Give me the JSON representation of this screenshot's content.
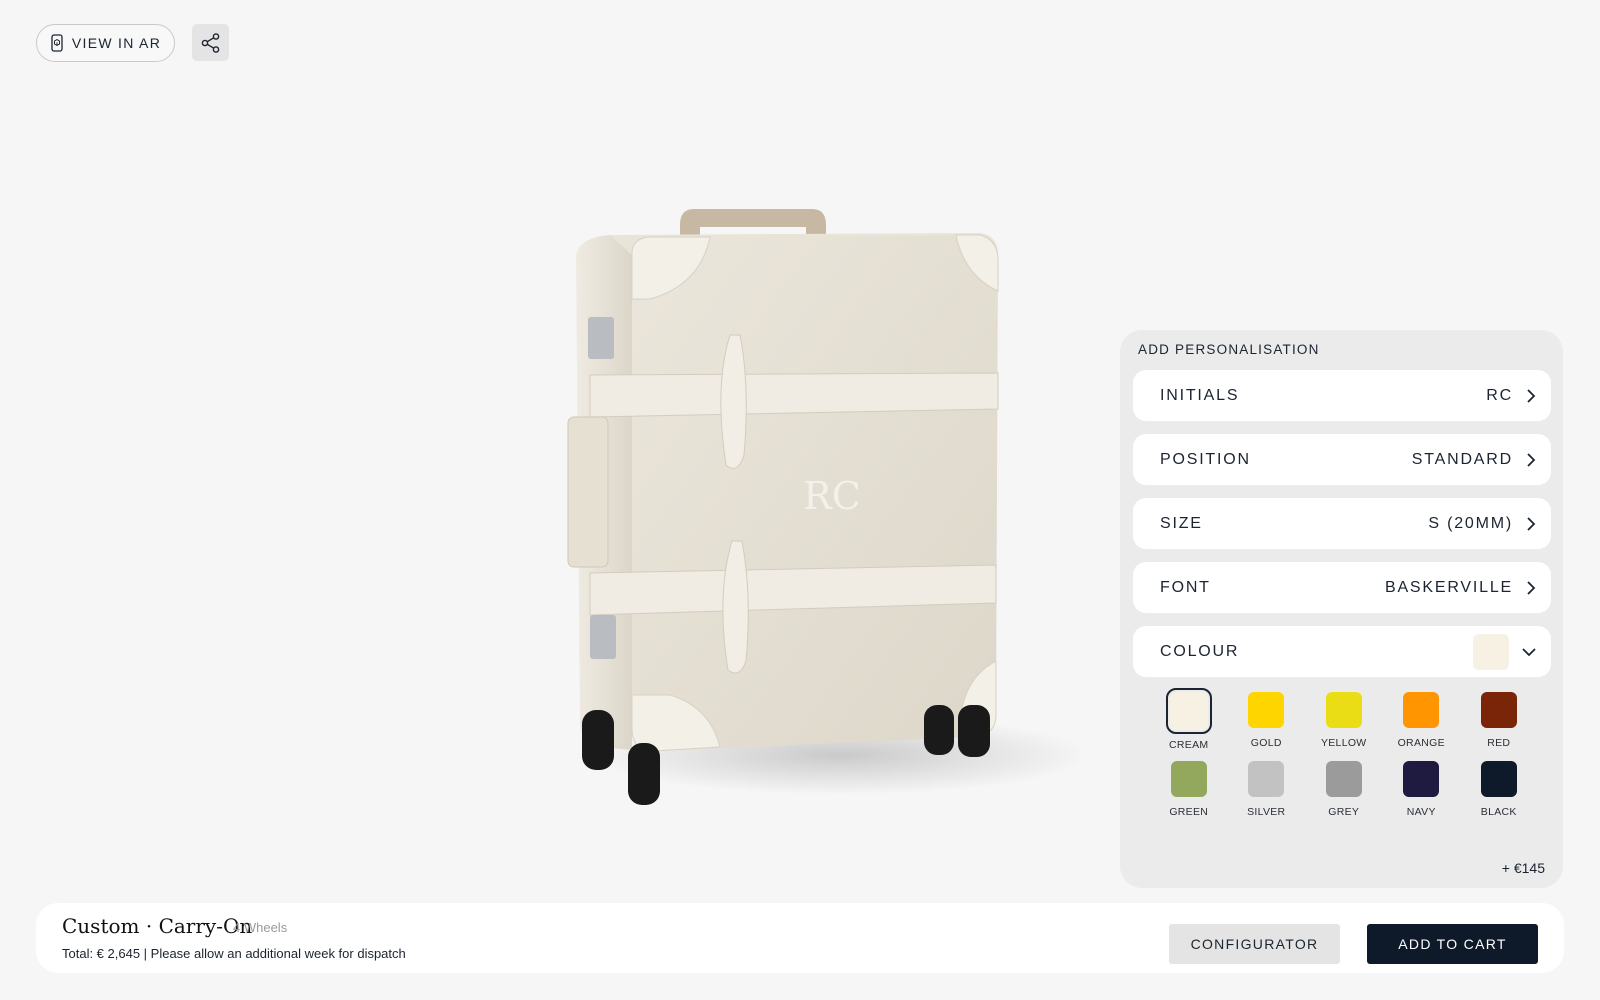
{
  "toolbar": {
    "ar_label": "VIEW IN AR",
    "ar_icon": "ar-phone-icon",
    "share_icon": "share-icon"
  },
  "product_view": {
    "monogram": "RC",
    "case_color": "#e6e0d4"
  },
  "personalisation": {
    "title": "ADD PERSONALISATION",
    "rows": [
      {
        "label": "INITIALS",
        "value": "RC"
      },
      {
        "label": "POSITION",
        "value": "STANDARD"
      },
      {
        "label": "SIZE",
        "value": "S (20MM)"
      },
      {
        "label": "FONT",
        "value": "BASKERVILLE"
      },
      {
        "label": "COLOUR",
        "value": ""
      }
    ],
    "selected_colour": "#f7f1e4",
    "colours": [
      {
        "name": "CREAM",
        "hex": "#f7f1e4",
        "selected": true
      },
      {
        "name": "GOLD",
        "hex": "#ffd500"
      },
      {
        "name": "YELLOW",
        "hex": "#eadd16"
      },
      {
        "name": "ORANGE",
        "hex": "#ff9500"
      },
      {
        "name": "RED",
        "hex": "#7a2508"
      },
      {
        "name": "GREEN",
        "hex": "#94a85d"
      },
      {
        "name": "SILVER",
        "hex": "#c2c2c2"
      },
      {
        "name": "GREY",
        "hex": "#9b9b9b"
      },
      {
        "name": "NAVY",
        "hex": "#1e1a40"
      },
      {
        "name": "BLACK",
        "hex": "#0e1a29"
      }
    ],
    "extra_price": "+ €145"
  },
  "footer": {
    "product_name": "Custom · Carry-On",
    "variant": "4 Wheels",
    "total": "Total: € 2,645 | Please allow an additional week for dispatch",
    "configurator_label": "CONFIGURATOR",
    "cart_label": "ADD TO CART"
  }
}
